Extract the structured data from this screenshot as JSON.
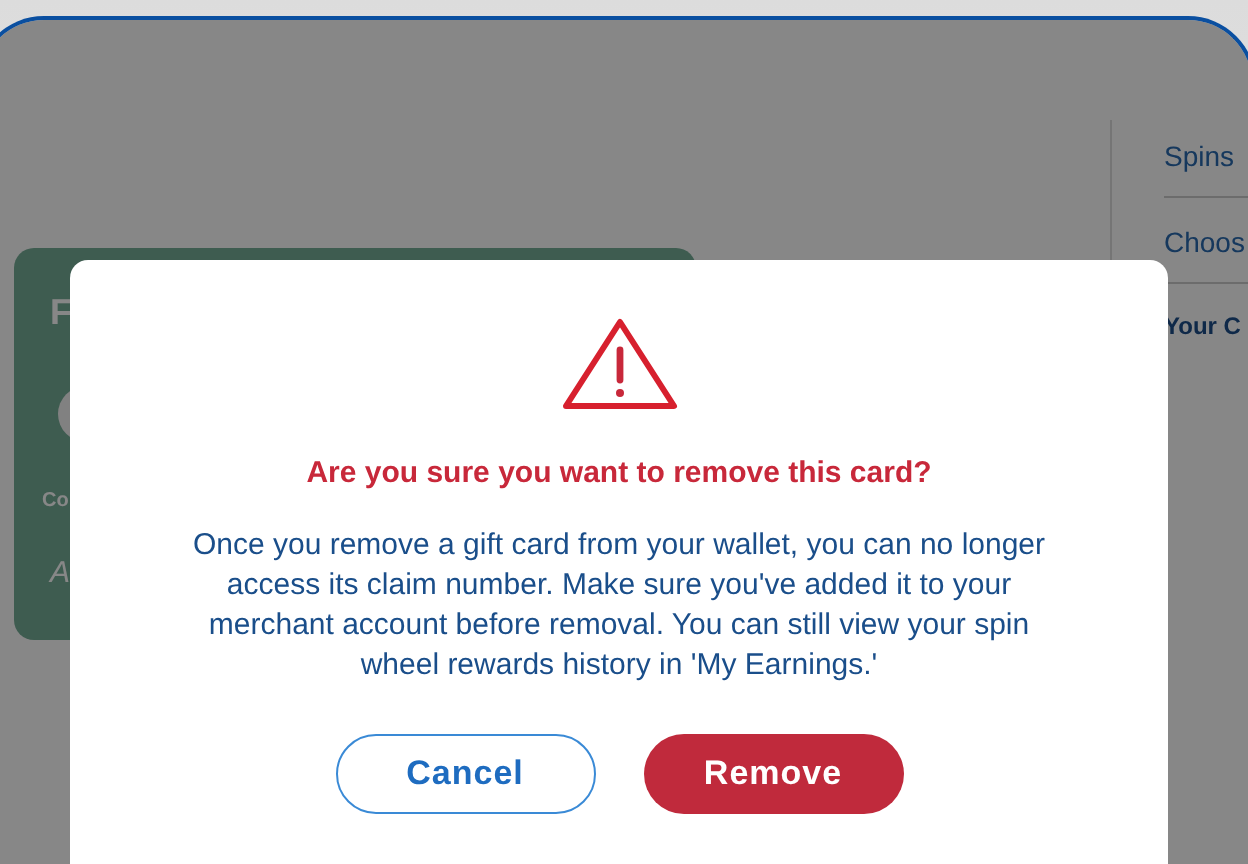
{
  "page": {
    "card": {
      "title": "F",
      "label": "Co",
      "note": "A"
    },
    "sidebar": {
      "items": [
        {
          "label": "Spins",
          "kind": "link"
        },
        {
          "label": "Choos",
          "kind": "link"
        },
        {
          "label": "Your C",
          "kind": "heading"
        }
      ]
    }
  },
  "dialog": {
    "title": "Are you sure you want to remove this card?",
    "message": "Once you remove a gift card from your wallet, you can no longer access its claim number. Make sure you've added it to your merchant account before removal. You can still view your spin wheel rewards history in 'My Earnings.'",
    "buttons": [
      {
        "label": "Cancel",
        "kind": "secondary"
      },
      {
        "label": "Remove",
        "kind": "primary"
      }
    ]
  }
}
